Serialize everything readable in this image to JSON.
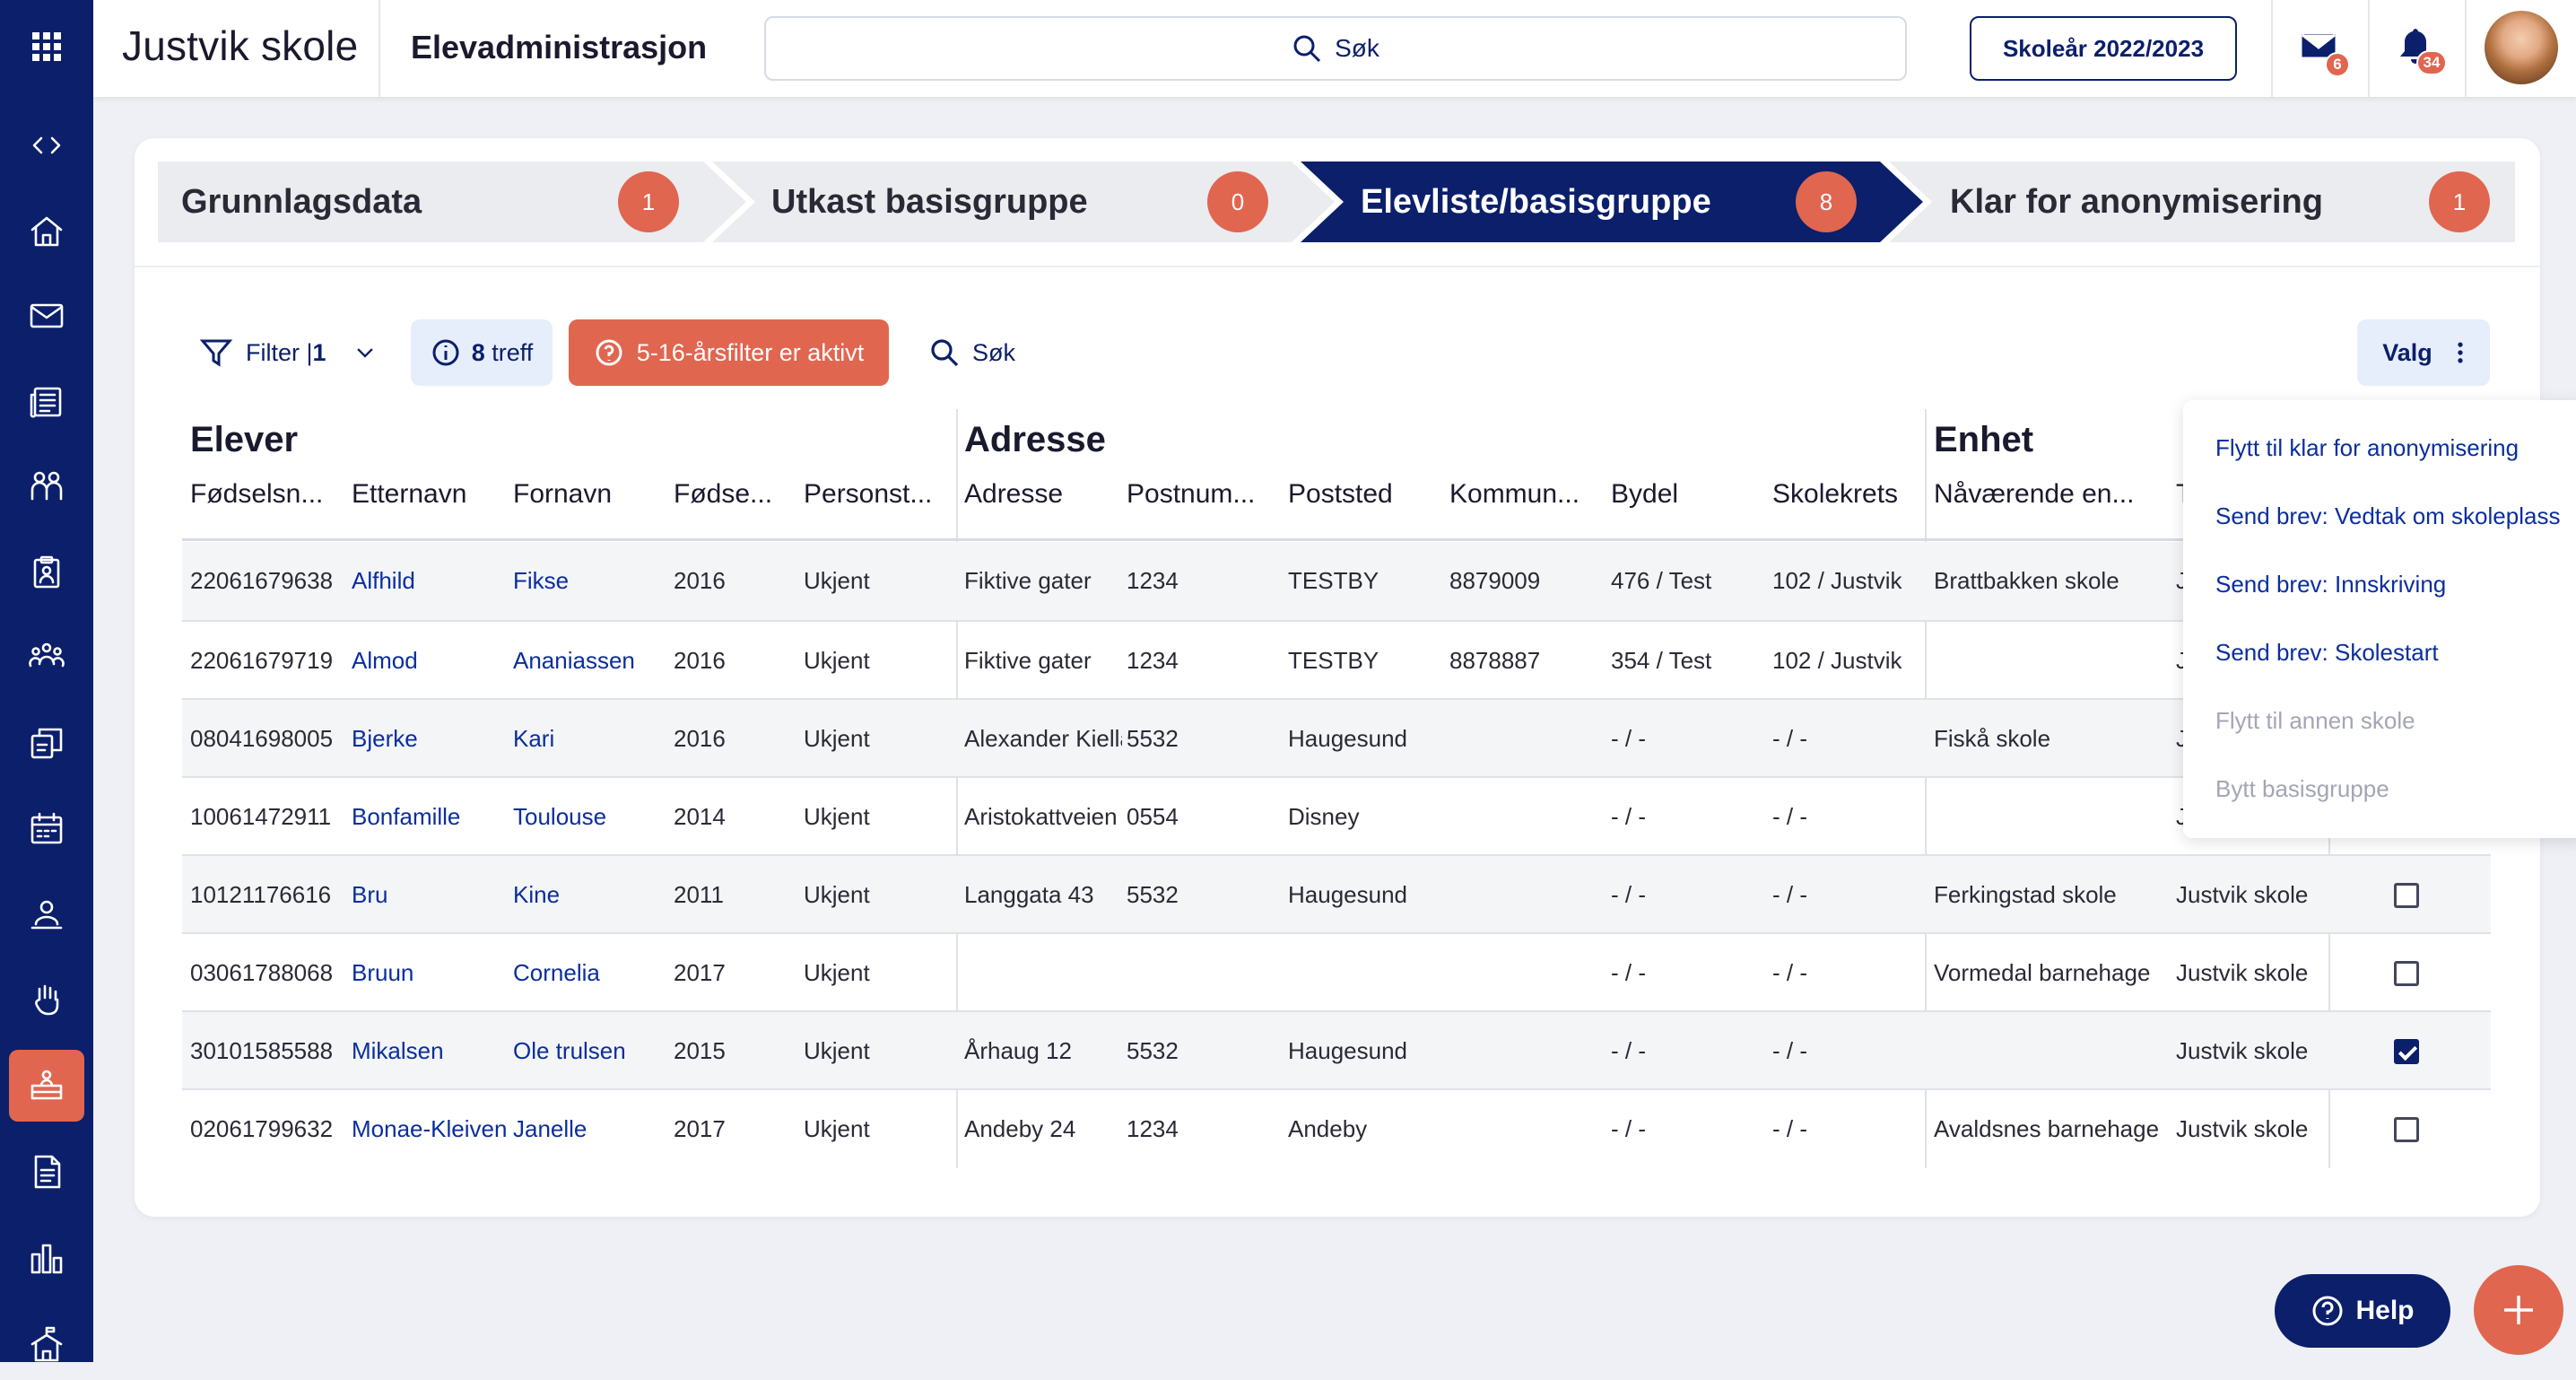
{
  "app": {
    "brand": "Justvik skole",
    "module": "Elevadministrasjon",
    "search_label": "Søk",
    "school_year": "Skoleår 2022/2023",
    "mail_count": "6",
    "notification_count": "34"
  },
  "sidebar": {
    "items": [
      "apps-grid-icon",
      "collapse-toggle-icon",
      "home-icon",
      "mail-icon",
      "news-icon",
      "people-icon",
      "clipboard-icon",
      "groups-icon",
      "edit-document-icon",
      "calendar-icon",
      "teacher-icon",
      "hand-icon",
      "classroom-icon",
      "document-icon",
      "chart-icon",
      "school-icon"
    ],
    "active": "classroom-icon"
  },
  "steps": [
    {
      "label": "Grunnlagsdata",
      "count": "1"
    },
    {
      "label": "Utkast basisgruppe",
      "count": "0"
    },
    {
      "label": "Elevliste/basisgruppe",
      "count": "8"
    },
    {
      "label": "Klar for anonymisering",
      "count": "1"
    }
  ],
  "active_step": 2,
  "toolbar": {
    "filter_label": "Filter |",
    "filter_count": "1",
    "treff_count": "8",
    "treff_label": "treff",
    "age_filter_label": "5-16-årsfilter er aktivt",
    "search_label": "Søk",
    "valg_label": "Valg"
  },
  "groups": {
    "elever": "Elever",
    "adresse": "Adresse",
    "enhet": "Enhet"
  },
  "columns": [
    "Fødselsn...",
    "Etternavn",
    "Fornavn",
    "Fødse...",
    "Personst...",
    "Adresse",
    "Postnum...",
    "Poststed",
    "Kommun...",
    "Bydel",
    "Skolekrets",
    "Nåværende en...",
    "T"
  ],
  "rows": [
    {
      "fnr": "22061679638",
      "etternavn": "Alfhild",
      "fornavn": "Fikse",
      "aar": "2016",
      "status": "Ukjent",
      "adresse": "Fiktive gater",
      "postnr": "1234",
      "poststed": "TESTBY",
      "kommune": "8879009",
      "bydel": "476 / Test",
      "skolekrets": "102 / Justvik",
      "naavaerende": "Brattbakken skole",
      "skole": "Justvik skole",
      "checked": false
    },
    {
      "fnr": "22061679719",
      "etternavn": "Almod",
      "fornavn": "Ananiassen",
      "aar": "2016",
      "status": "Ukjent",
      "adresse": "Fiktive gater",
      "postnr": "1234",
      "poststed": "TESTBY",
      "kommune": "8878887",
      "bydel": "354 / Test",
      "skolekrets": "102 / Justvik",
      "naavaerende": "",
      "skole": "Justvik skole",
      "checked": false
    },
    {
      "fnr": "08041698005",
      "etternavn": "Bjerke",
      "fornavn": "Kari",
      "aar": "2016",
      "status": "Ukjent",
      "adresse": "Alexander Kielland",
      "postnr": "5532",
      "poststed": "Haugesund",
      "kommune": "",
      "bydel": "- / -",
      "skolekrets": "- / -",
      "naavaerende": "Fiskå skole",
      "skole": "Justvik skole",
      "checked": false
    },
    {
      "fnr": "10061472911",
      "etternavn": "Bonfamille",
      "fornavn": "Toulouse",
      "aar": "2014",
      "status": "Ukjent",
      "adresse": "Aristokattveien",
      "postnr": "0554",
      "poststed": "Disney",
      "kommune": "",
      "bydel": "- / -",
      "skolekrets": "- / -",
      "naavaerende": "",
      "skole": "Justvik skole",
      "checked": false
    },
    {
      "fnr": "10121176616",
      "etternavn": "Bru",
      "fornavn": "Kine",
      "aar": "2011",
      "status": "Ukjent",
      "adresse": "Langgata 43",
      "postnr": "5532",
      "poststed": "Haugesund",
      "kommune": "",
      "bydel": "- / -",
      "skolekrets": "- / -",
      "naavaerende": "Ferkingstad skole",
      "skole": "Justvik skole",
      "checked": false
    },
    {
      "fnr": "03061788068",
      "etternavn": "Bruun",
      "fornavn": "Cornelia",
      "aar": "2017",
      "status": "Ukjent",
      "adresse": "",
      "postnr": "",
      "poststed": "",
      "kommune": "",
      "bydel": "- / -",
      "skolekrets": "- / -",
      "naavaerende": "Vormedal barnehage",
      "skole": "Justvik skole",
      "checked": false
    },
    {
      "fnr": "30101585588",
      "etternavn": "Mikalsen",
      "fornavn": "Ole trulsen",
      "aar": "2015",
      "status": "Ukjent",
      "adresse": "Århaug 12",
      "postnr": "5532",
      "poststed": "Haugesund",
      "kommune": "",
      "bydel": "- / -",
      "skolekrets": "- / -",
      "naavaerende": "",
      "skole": "Justvik skole",
      "checked": true
    },
    {
      "fnr": "02061799632",
      "etternavn": "Monae-Kleiven",
      "fornavn": "Janelle",
      "aar": "2017",
      "status": "Ukjent",
      "adresse": "Andeby 24",
      "postnr": "1234",
      "poststed": "Andeby",
      "kommune": "",
      "bydel": "- / -",
      "skolekrets": "- / -",
      "naavaerende": "Avaldsnes barnehage",
      "skole": "Justvik skole",
      "checked": false
    }
  ],
  "menu": [
    {
      "label": "Flytt til klar for anonymisering",
      "enabled": true
    },
    {
      "label": "Send brev: Vedtak om skoleplass",
      "enabled": true
    },
    {
      "label": "Send brev: Innskriving",
      "enabled": true
    },
    {
      "label": "Send brev: Skolestart",
      "enabled": true
    },
    {
      "label": "Flytt til annen skole",
      "enabled": false
    },
    {
      "label": "Bytt basisgruppe",
      "enabled": false
    }
  ],
  "help_label": "Help",
  "colors": {
    "navy": "#0b1f6b",
    "accent": "#e06650",
    "link": "#0b2e9e"
  }
}
